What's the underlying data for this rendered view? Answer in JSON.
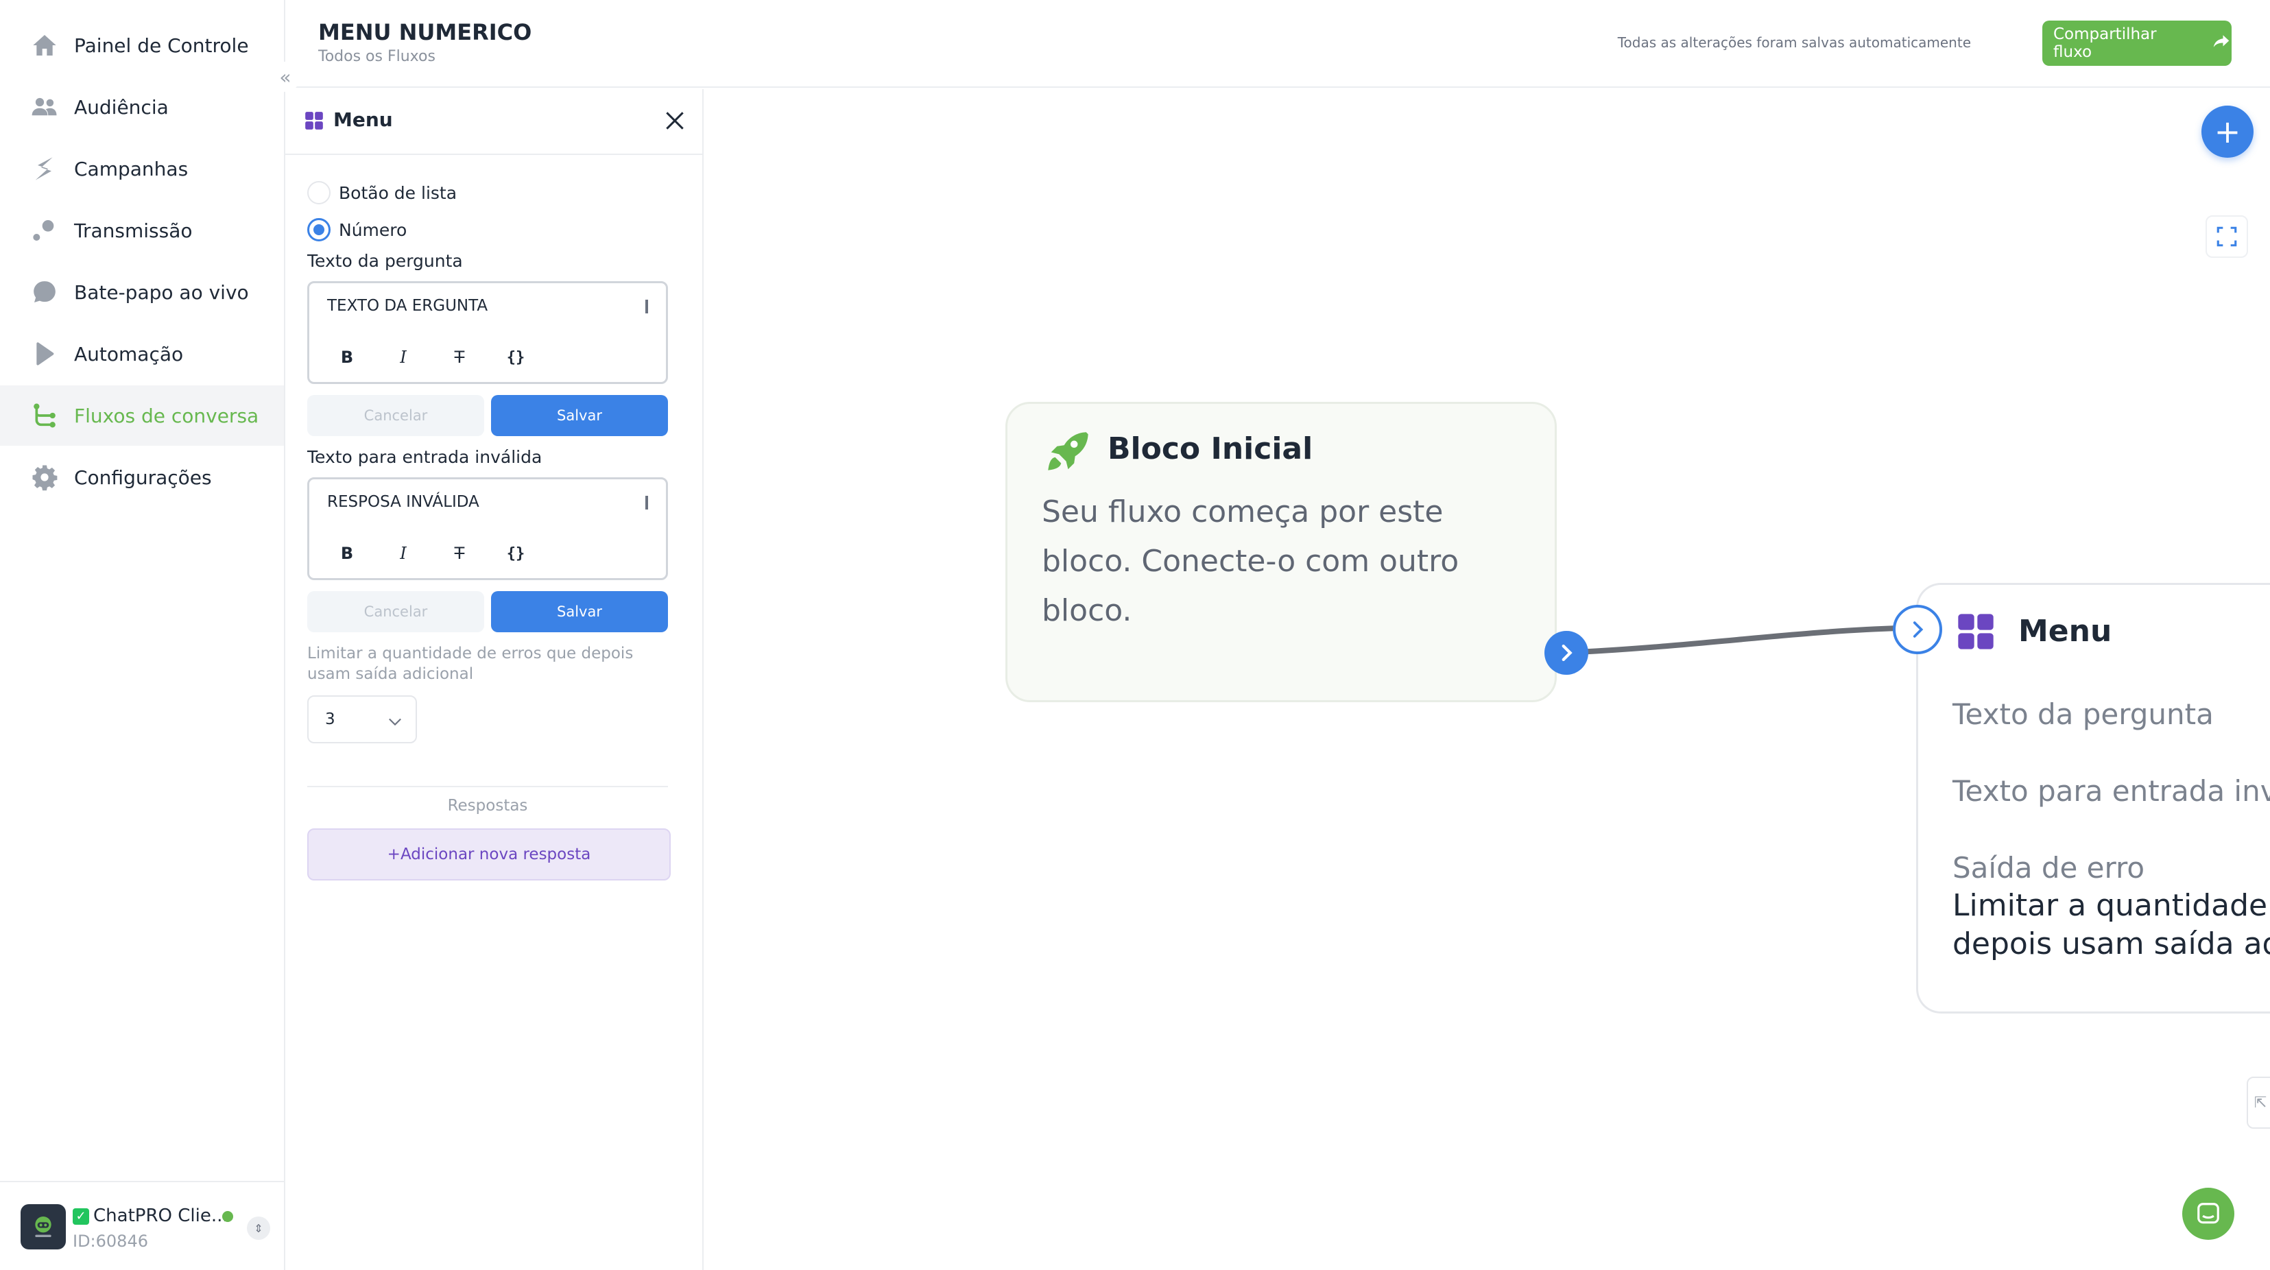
{
  "sidebar": {
    "items": [
      {
        "label": "Painel de Controle",
        "icon": "home-icon"
      },
      {
        "label": "Audiência",
        "icon": "users-icon"
      },
      {
        "label": "Campanhas",
        "icon": "campaign-icon"
      },
      {
        "label": "Transmissão",
        "icon": "broadcast-icon"
      },
      {
        "label": "Bate-papo ao vivo",
        "icon": "chat-bubble-icon"
      },
      {
        "label": "Automação",
        "icon": "automation-icon"
      },
      {
        "label": "Fluxos de conversa",
        "icon": "flow-icon"
      },
      {
        "label": "Configurações",
        "icon": "gear-icon"
      }
    ],
    "active_index": 6,
    "account": {
      "name": "ChatPRO Clie...",
      "id": "ID:60846",
      "status_color": "#67b84f"
    }
  },
  "header": {
    "title": "MENU NUMERICO",
    "breadcrumb": "Todos os Fluxos",
    "save_status": "Todas as alterações foram salvas automaticamente",
    "share_label": "Compartilhar fluxo"
  },
  "panel": {
    "title": "Menu",
    "options": {
      "list_button": "Botão de lista",
      "number": "Número",
      "selected": "number"
    },
    "question": {
      "label": "Texto da pergunta",
      "value": "TEXTO DA ERGUNTA",
      "cancel": "Cancelar",
      "save": "Salvar"
    },
    "invalid": {
      "label": "Texto para entrada inválida",
      "value": "RESPOSA INVÁLIDA",
      "cancel": "Cancelar",
      "save": "Salvar"
    },
    "tools": {
      "bold": "B",
      "italic": "I",
      "strike": "T",
      "variable": "{}"
    },
    "error_limit_hint": "Limitar a quantidade de erros que depois usam saída adicional",
    "error_limit_value": "3",
    "responses_label": "Respostas",
    "add_response": "+Adicionar nova resposta"
  },
  "canvas": {
    "start_block": {
      "title": "Bloco Inicial",
      "description": "Seu fluxo começa por este bloco. Conecte-o com outro bloco."
    },
    "menu_block": {
      "title": "Menu",
      "question_label": "Texto da pergunta",
      "invalid_label": "Texto para entrada inváli",
      "error_exit_label": "Saída de erro",
      "error_limit_line1": "Limitar a quantidade de",
      "error_limit_line2": "depois usam saída adic"
    },
    "add_button": "+"
  },
  "colors": {
    "accent": "#3b82e6",
    "brand_green": "#67b84f",
    "menu_purple": "#6b46c1"
  }
}
